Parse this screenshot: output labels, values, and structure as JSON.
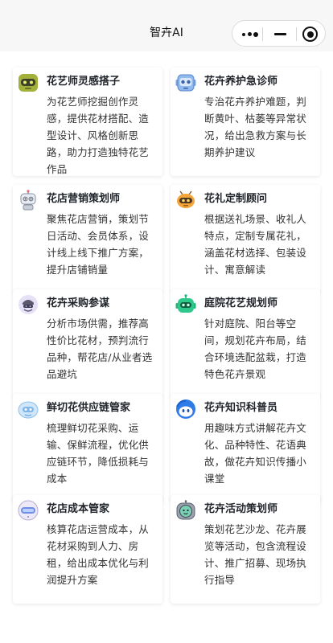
{
  "navbar": {
    "title": "智卉AI",
    "menu": {
      "more_icon": "more-dots-icon",
      "minimize_icon": "minimize-icon",
      "close_icon": "close-target-icon"
    }
  },
  "cards": [
    {
      "title": "花艺师灵感搭子",
      "desc": "为花艺师挖掘创作灵感，提供花材搭配、造型设计、风格创新思路，助力打造独特花艺作品",
      "icon": "olive-robot-icon"
    },
    {
      "title": "花卉养护急诊师",
      "desc": "专治花卉养护难题，判断黄叶、枯萎等异常状况，给出急救方案与长期养护建议",
      "icon": "blue-robot-icon"
    },
    {
      "title": "花店营销策划师",
      "desc": "聚焦花店营销，策划节日活动、会员体系，设计线上线下推广方案，提升店铺销量",
      "icon": "antenna-robot-icon"
    },
    {
      "title": "花礼定制顾问",
      "desc": "根据送礼场景、收礼人特点，定制专属花礼，涵盖花材选择、包装设计、寓意解读",
      "icon": "orange-robot-icon"
    },
    {
      "title": "花卉采购参谋",
      "desc": "分析市场供需，推荐高性价比花材，预判流行品种，帮花店/从业者选品避坑",
      "icon": "purple-robot-icon"
    },
    {
      "title": "庭院花艺规划师",
      "desc": "针对庭院、阳台等空间，规划花卉布局，结合环境选配盆栽，打造特色花卉景观",
      "icon": "green-robot-icon"
    },
    {
      "title": "鲜切花供应链管家",
      "desc": "梳理鲜切花采购、运输、保鲜流程，优化供应链环节，降低损耗与成本",
      "icon": "cloud-robot-icon"
    },
    {
      "title": "花卉知识科普员",
      "desc": "用趣味方式讲解花卉文化、品种特性、花语典故，做花卉知识传播小课堂",
      "icon": "blue-bot-icon"
    },
    {
      "title": "花店成本管家",
      "desc": "核算花店运营成本，从花材采购到人力、房租，给出成本优化与利润提升方案",
      "icon": "visor-robot-icon"
    },
    {
      "title": "花卉活动策划师",
      "desc": "策划花艺沙龙、花卉展览等活动，包含流程设计、推广招募、现场执行指导",
      "icon": "gray-robot-icon"
    }
  ]
}
